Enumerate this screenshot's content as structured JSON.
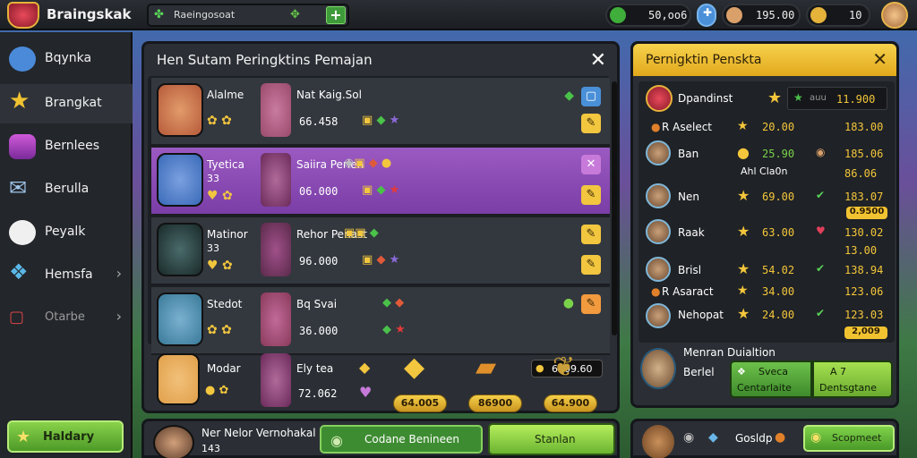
{
  "app": {
    "title": "Braingskak"
  },
  "search": {
    "text": "Raeingosoat"
  },
  "resources": [
    {
      "value": "50,oo6",
      "color": "#3fae3a"
    },
    {
      "value": "195.00",
      "color": "#d9a06a"
    },
    {
      "value": "10",
      "color": "#e5b23a"
    }
  ],
  "sidebar": {
    "items": [
      {
        "label": "Bqynka",
        "icon": "player-icon",
        "color": "#4a8ad9"
      },
      {
        "label": "Brangkat",
        "icon": "star-icon",
        "color": "#f1c331",
        "active": true
      },
      {
        "label": "Bernlees",
        "icon": "chest-icon",
        "color": "#b34ac9"
      },
      {
        "label": "Berulla",
        "icon": "mail-icon",
        "color": "#6aa5d8"
      },
      {
        "label": "Peyalk",
        "icon": "chat-icon",
        "color": "#f0f0f0"
      },
      {
        "label": "Hemsfa",
        "icon": "gems-icon",
        "color": "#5ab8e8",
        "chevron": "›"
      },
      {
        "label": "Otarbe",
        "icon": "settings-icon",
        "color": "#d9464a",
        "chevron": "›"
      }
    ],
    "highlight_button": "Haldary"
  },
  "main": {
    "title": "Hen Sutam Peringktins Pemajan",
    "rows": [
      {
        "name": "Alalme",
        "title2": "Nat Kaig.Sol",
        "score": "66.458",
        "avatar_color": "#b65a3a",
        "av2_color": "#9a4a6a"
      },
      {
        "name": "Tyetica",
        "sub": "33",
        "title2": "Saiira Perien",
        "score": "06.000",
        "avatar_color": "#3a6ab8",
        "av2_color": "#6a2a5a",
        "selected": true
      },
      {
        "name": "Matinor",
        "sub": "33",
        "title2": "Rehor Penast",
        "score": "96.000",
        "avatar_color": "#2a3a3a",
        "av2_color": "#5a2a4a"
      },
      {
        "name": "Stedot",
        "title2": "Bq Svai",
        "score": "36.000",
        "avatar_color": "#3a7a9a",
        "av2_color": "#8a3a5a"
      },
      {
        "name": "Modar",
        "title2": "Ely tea",
        "score": "72.062",
        "avatar_color": "#e0a04a",
        "av2_color": "#6a2a5a"
      }
    ],
    "coin_badge": "6909.60",
    "rewards": [
      "64.005",
      "86900",
      "64.900"
    ],
    "bottom": {
      "name": "Ner Nelor Vernohakal",
      "sub": "143",
      "outline_button": "Codane Benineen",
      "green_button": "Stanlan"
    }
  },
  "right_panel": {
    "title": "Pernigktin Penskta",
    "rows": [
      {
        "name": "Dpandinst",
        "extra": "auu",
        "value": "11.900"
      },
      {
        "name": "R Aselect",
        "v": "20.00",
        "right": "183.00"
      },
      {
        "name": "Ban",
        "v": "25.90",
        "right": "185.06",
        "sub": "Ahl Cla0n",
        "right2": "86.06"
      },
      {
        "name": "Nen",
        "v": "69.00",
        "right": "183.07",
        "tag": "0.9500"
      },
      {
        "name": "Raak",
        "v": "63.00",
        "right": "130.02",
        "right2": "13.00"
      },
      {
        "name": "Brisl",
        "v": "54.02",
        "right": "138.94"
      },
      {
        "name": "R Asaract",
        "v": "34.00",
        "right": "123.06"
      },
      {
        "name": "Nehopat",
        "v": "24.00",
        "right": "123.03",
        "tag": "2,009"
      }
    ],
    "footer": {
      "line1": "Menran Duialtion",
      "line2": "Berlel",
      "btn1_line1": "Sveca",
      "btn1_line2": "Centarlaite",
      "btn2_line1": "A    7",
      "btn2_line2": "Dentsgtane"
    },
    "bottom": {
      "label": "Gosldp",
      "button": "Scopmeet"
    }
  }
}
